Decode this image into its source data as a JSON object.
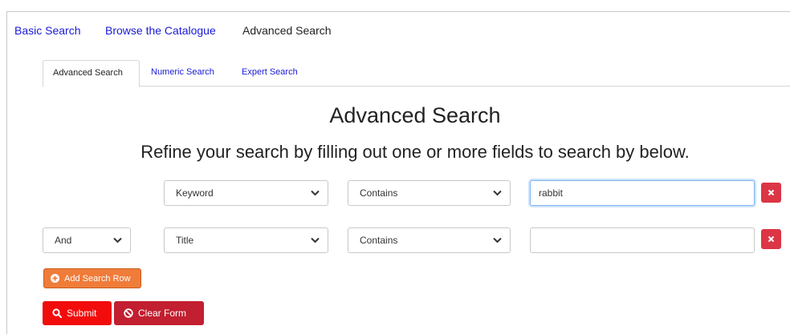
{
  "topnav": {
    "basic_search": "Basic Search",
    "browse": "Browse the Catalogue",
    "advanced": "Advanced Search"
  },
  "tabs": [
    {
      "label": "Advanced Search",
      "active": true
    },
    {
      "label": "Numeric Search",
      "active": false
    },
    {
      "label": "Expert Search",
      "active": false
    }
  ],
  "page": {
    "title": "Advanced Search",
    "subtitle": "Refine your search by filling out one or more fields to search by below."
  },
  "rows": [
    {
      "operator": "",
      "field": "Keyword",
      "match": "Contains",
      "value": "rabbit"
    },
    {
      "operator": "And",
      "field": "Title",
      "match": "Contains",
      "value": ""
    }
  ],
  "buttons": {
    "add_row": "Add Search Row",
    "submit": "Submit",
    "clear": "Clear Form"
  },
  "colors": {
    "link": "#1a1ad6",
    "remove": "#dc3545",
    "add": "#f07c3a",
    "submit": "#f20c0c",
    "clear": "#c21f30"
  }
}
